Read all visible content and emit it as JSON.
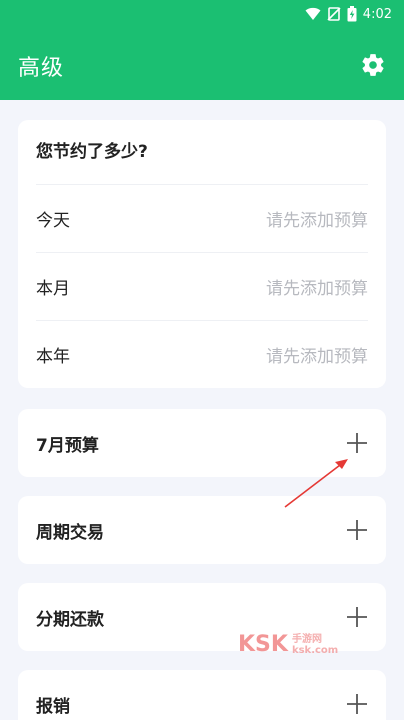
{
  "status_bar": {
    "time": "4:02",
    "icons": [
      "wifi-icon",
      "no-signal-icon",
      "battery-charging-icon"
    ]
  },
  "header": {
    "title": "高级",
    "settings_icon": "gear-icon"
  },
  "summary": {
    "title": "您节约了多少?",
    "rows": [
      {
        "label": "今天",
        "value": "请先添加预算"
      },
      {
        "label": "本月",
        "value": "请先添加预算"
      },
      {
        "label": "本年",
        "value": "请先添加预算"
      }
    ]
  },
  "sections": [
    {
      "label": "7月预算",
      "icon": "plus-icon"
    },
    {
      "label": "周期交易",
      "icon": "plus-icon"
    },
    {
      "label": "分期还款",
      "icon": "plus-icon"
    },
    {
      "label": "报销",
      "icon": "plus-icon"
    }
  ],
  "watermark": {
    "logo": "KSK",
    "line1": "手游网",
    "line2": "ksk.com"
  },
  "colors": {
    "header_bg": "#1bbf72",
    "page_bg": "#f3f5fb",
    "card_bg": "#ffffff",
    "placeholder_text": "#b7b9bf",
    "annotation_arrow": "#e53935"
  }
}
